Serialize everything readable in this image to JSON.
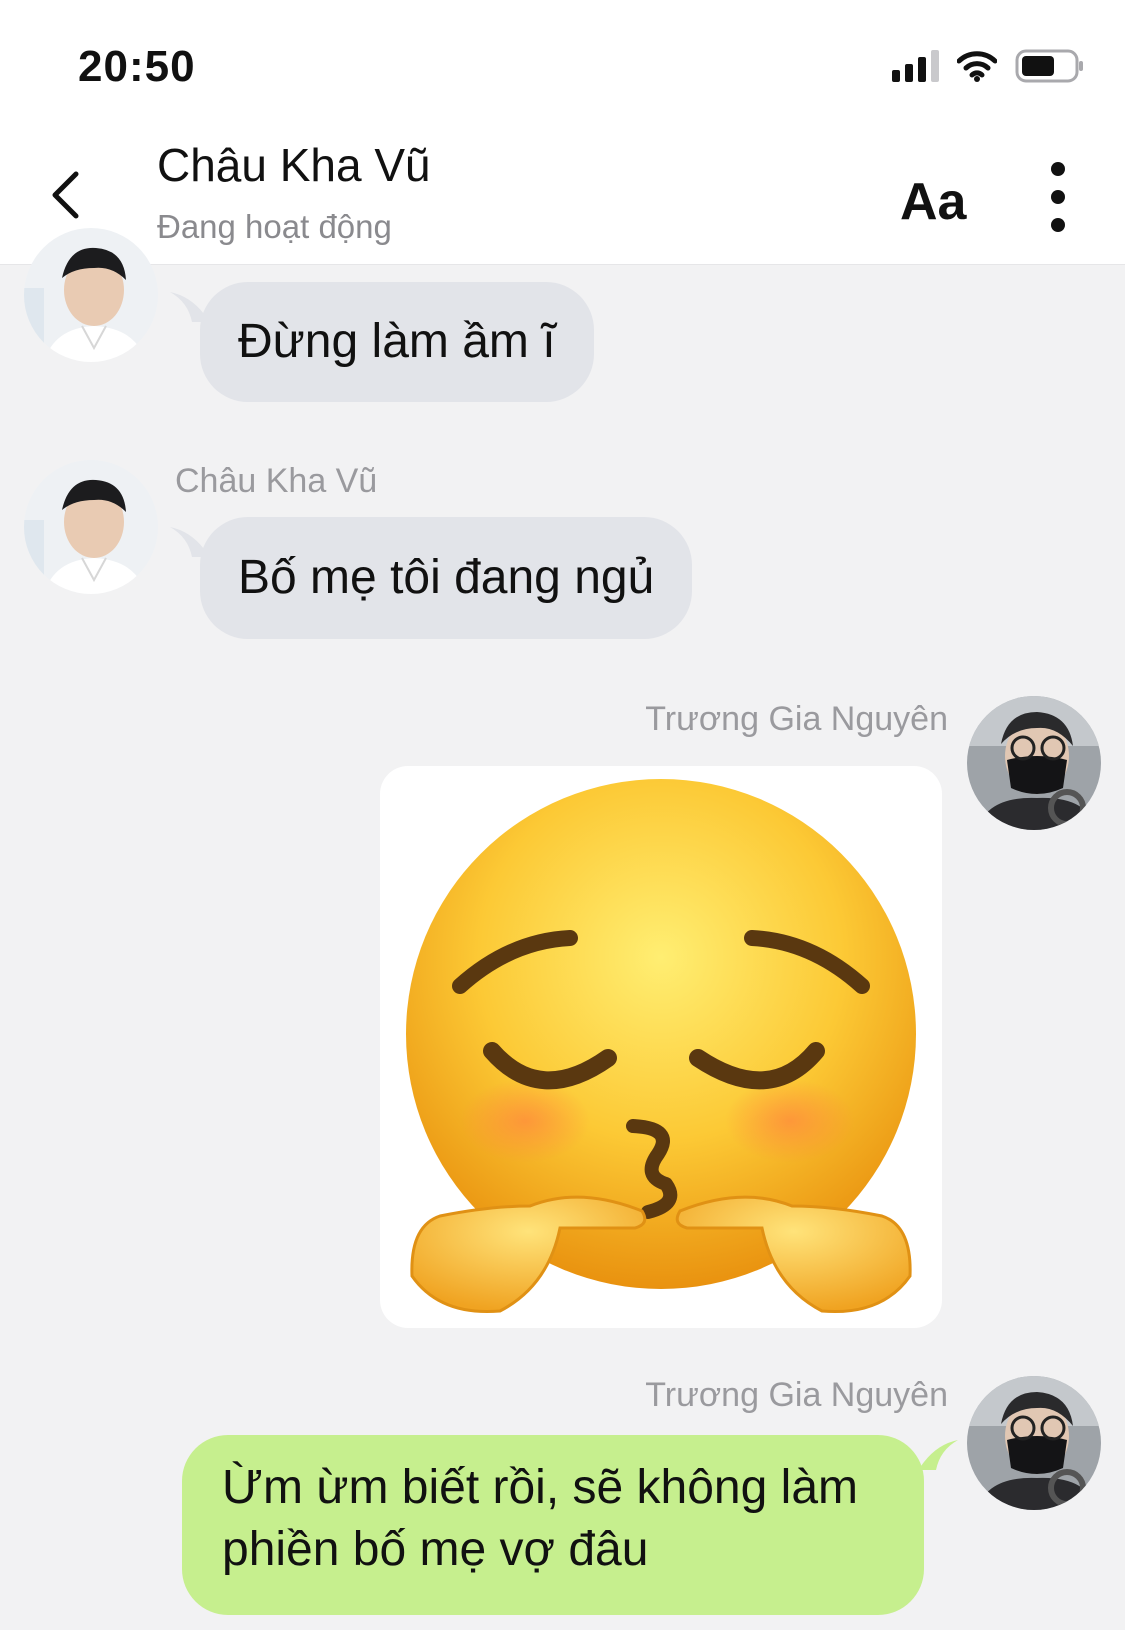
{
  "status_bar": {
    "time": "20:50"
  },
  "header": {
    "contact_name": "Châu Kha Vũ",
    "contact_status": "Đang hoạt động",
    "font_size_label": "Aa"
  },
  "messages": [
    {
      "sender": "",
      "text": "Đừng làm ầm ĩ"
    },
    {
      "sender": "Châu Kha Vũ",
      "text": "Bố mẹ tôi đang ngủ"
    },
    {
      "sender": "Trương Gia Nguyên",
      "sticker": "pensive-kiss-emoji"
    },
    {
      "sender": "Trương Gia Nguyên",
      "text_line1": "Ừm ừm biết rồi, sẽ không làm",
      "text_line2": "phiền bố mẹ vợ đâu"
    }
  ],
  "colors": {
    "incoming_bubble": "#e2e4e9",
    "outgoing_bubble": "#c6ef8e",
    "background": "#f2f2f3"
  }
}
